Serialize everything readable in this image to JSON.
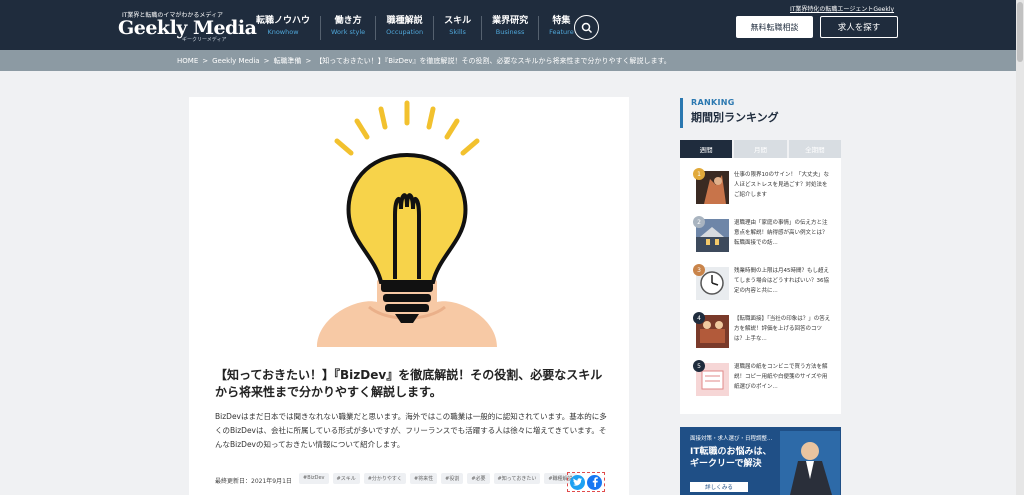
{
  "header": {
    "logo_tagline": "IT業界と転職のイマがわかるメディア",
    "logo": "Geekly Media",
    "logo_sub": "ギークリーメディア",
    "top_link": "IT業界特化の転職エージェントGeekly",
    "nav": [
      {
        "jp": "転職ノウハウ",
        "en": "Knowhow"
      },
      {
        "jp": "働き方",
        "en": "Work style"
      },
      {
        "jp": "職種解説",
        "en": "Occupation"
      },
      {
        "jp": "スキル",
        "en": "Skills"
      },
      {
        "jp": "業界研究",
        "en": "Business"
      },
      {
        "jp": "特集",
        "en": "Feature"
      }
    ],
    "btn_free": "無料転職相談",
    "btn_job": "求人を探す"
  },
  "breadcrumb": [
    "HOME",
    ">",
    "Geekly Media",
    ">",
    "転職準備",
    ">",
    "【知っておきたい！】『BizDev』を徹底解説！その役割、必要なスキルから将来性まで分かりやすく解説します。"
  ],
  "article": {
    "title": "【知っておきたい！】『BizDev』を徹底解説！その役割、必要なスキルから将来性まで分かりやすく解説します。",
    "description": "BizDevはまだ日本では聞きなれない職業だと思います。海外ではこの職業は一般的に認知されています。基本的に多くのBizDevは、会社に所属している形式が多いですが、フリーランスでも活躍する人は徐々に増えてきています。そんなBizDevの知っておきたい情報について紹介します。",
    "updated": "最終更新日：2021年9月1日",
    "tags": [
      "#BizDev",
      "#スキル",
      "#分かりやすく",
      "#将来性",
      "#役割",
      "#必要",
      "#知っておきたい",
      "#職種解説"
    ]
  },
  "sidebar": {
    "ranking_en": "RANKING",
    "ranking_jp": "期間別ランキング",
    "tabs": [
      "週間",
      "月間",
      "全期間"
    ],
    "items": [
      {
        "num": "1",
        "text": "仕事の限界10のサイン！「大丈夫」な人ほどストレスを見過ごす？対処法をご紹介します"
      },
      {
        "num": "2",
        "text": "退職理由「家庭の事情」の伝え方と注意点を解説！納得感が高い例文とは？転職面接での話..."
      },
      {
        "num": "3",
        "text": "残業時間の上限は月45時間？もし超えてしまう場合はどうすればいい？36協定の内容と共に..."
      },
      {
        "num": "4",
        "text": "【転職面接】「当社の印象は？」の答え方を解説！評価を上げる回答のコツは？上手な..."
      },
      {
        "num": "5",
        "text": "退職届の紙をコンビニで買う方法を解説！コピー用紙や白便箋のサイズや用紙選びのポイン..."
      }
    ],
    "banner": {
      "small": "面接対策・求人選び・日程調整...",
      "line1": "IT転職のお悩みは、",
      "line2": "ギークリーで解決",
      "btn": "詳しくみる"
    }
  },
  "colors": {
    "header_bg": "#1f2c3d",
    "accent": "#2b78b0",
    "breadcrumb_bg": "#8c9aa3"
  }
}
